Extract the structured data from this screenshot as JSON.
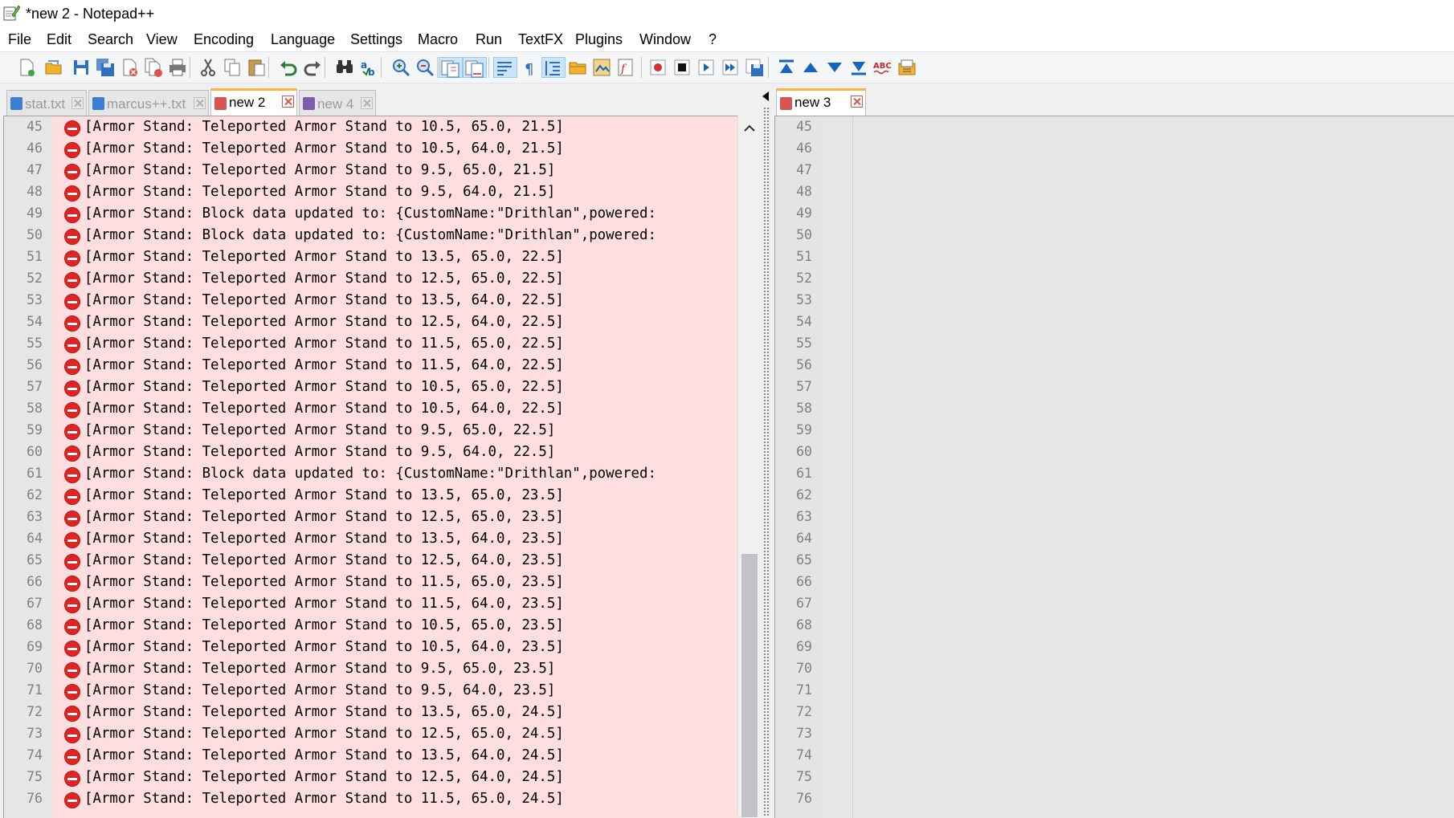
{
  "window": {
    "title": "*new  2 - Notepad++"
  },
  "menu": [
    "File",
    "Edit",
    "Search",
    "View",
    "Encoding",
    "Language",
    "Settings",
    "Macro",
    "Run",
    "TextFX",
    "Plugins",
    "Window",
    "?"
  ],
  "toolbar_icons": [
    "new-file-icon",
    "open-file-icon",
    "save-icon",
    "save-all-icon",
    "close-icon",
    "close-all-icon",
    "print-icon",
    "cut-icon",
    "copy-icon",
    "paste-icon",
    "undo-icon",
    "redo-icon",
    "find-icon",
    "replace-icon",
    "zoom-in-icon",
    "zoom-out-icon",
    "sync-vertical-icon",
    "sync-horizontal-icon",
    "word-wrap-icon",
    "show-all-chars-icon",
    "indent-guide-icon",
    "folder-icon",
    "document-map-icon",
    "function-list-icon",
    "record-macro-icon",
    "stop-recording-icon",
    "play-macro-icon",
    "run-macro-multiple-icon",
    "save-macro-icon",
    "first-diff-icon",
    "prev-diff-icon",
    "next-diff-icon",
    "last-diff-icon",
    "spell-check-icon",
    "compare-icon"
  ],
  "tabs_left": [
    {
      "label": "stat.txt",
      "color": "#3b7fd4",
      "active": false
    },
    {
      "label": "marcus++.txt",
      "color": "#3b7fd4",
      "active": false
    },
    {
      "label": "new  2",
      "color": "#d9534f",
      "active": true
    },
    {
      "label": "new  4",
      "color": "#7a5fb0",
      "active": false
    }
  ],
  "tabs_right": [
    {
      "label": "new  3",
      "color": "#d9534f",
      "active": true
    }
  ],
  "colors": {
    "removed_line_bg": "#ffdedf",
    "marker": "#e02424",
    "active_tab_accent": "#fab540"
  },
  "left_lines": [
    {
      "n": "45",
      "text": "[Armor Stand: Teleported Armor Stand to 10.5, 65.0, 21.5]"
    },
    {
      "n": "46",
      "text": "[Armor Stand: Teleported Armor Stand to 10.5, 64.0, 21.5]"
    },
    {
      "n": "47",
      "text": "[Armor Stand: Teleported Armor Stand to 9.5, 65.0, 21.5]"
    },
    {
      "n": "48",
      "text": "[Armor Stand: Teleported Armor Stand to 9.5, 64.0, 21.5]"
    },
    {
      "n": "49",
      "text": "[Armor Stand: Block data updated to: {CustomName:\"Drithlan\",powered:"
    },
    {
      "n": "50",
      "text": "[Armor Stand: Block data updated to: {CustomName:\"Drithlan\",powered:"
    },
    {
      "n": "51",
      "text": "[Armor Stand: Teleported Armor Stand to 13.5, 65.0, 22.5]"
    },
    {
      "n": "52",
      "text": "[Armor Stand: Teleported Armor Stand to 12.5, 65.0, 22.5]"
    },
    {
      "n": "53",
      "text": "[Armor Stand: Teleported Armor Stand to 13.5, 64.0, 22.5]"
    },
    {
      "n": "54",
      "text": "[Armor Stand: Teleported Armor Stand to 12.5, 64.0, 22.5]"
    },
    {
      "n": "55",
      "text": "[Armor Stand: Teleported Armor Stand to 11.5, 65.0, 22.5]"
    },
    {
      "n": "56",
      "text": "[Armor Stand: Teleported Armor Stand to 11.5, 64.0, 22.5]"
    },
    {
      "n": "57",
      "text": "[Armor Stand: Teleported Armor Stand to 10.5, 65.0, 22.5]"
    },
    {
      "n": "58",
      "text": "[Armor Stand: Teleported Armor Stand to 10.5, 64.0, 22.5]"
    },
    {
      "n": "59",
      "text": "[Armor Stand: Teleported Armor Stand to 9.5, 65.0, 22.5]"
    },
    {
      "n": "60",
      "text": "[Armor Stand: Teleported Armor Stand to 9.5, 64.0, 22.5]"
    },
    {
      "n": "61",
      "text": "[Armor Stand: Block data updated to: {CustomName:\"Drithlan\",powered:"
    },
    {
      "n": "62",
      "text": "[Armor Stand: Teleported Armor Stand to 13.5, 65.0, 23.5]"
    },
    {
      "n": "63",
      "text": "[Armor Stand: Teleported Armor Stand to 12.5, 65.0, 23.5]"
    },
    {
      "n": "64",
      "text": "[Armor Stand: Teleported Armor Stand to 13.5, 64.0, 23.5]"
    },
    {
      "n": "65",
      "text": "[Armor Stand: Teleported Armor Stand to 12.5, 64.0, 23.5]"
    },
    {
      "n": "66",
      "text": "[Armor Stand: Teleported Armor Stand to 11.5, 65.0, 23.5]"
    },
    {
      "n": "67",
      "text": "[Armor Stand: Teleported Armor Stand to 11.5, 64.0, 23.5]"
    },
    {
      "n": "68",
      "text": "[Armor Stand: Teleported Armor Stand to 10.5, 65.0, 23.5]"
    },
    {
      "n": "69",
      "text": "[Armor Stand: Teleported Armor Stand to 10.5, 64.0, 23.5]"
    },
    {
      "n": "70",
      "text": "[Armor Stand: Teleported Armor Stand to 9.5, 65.0, 23.5]"
    },
    {
      "n": "71",
      "text": "[Armor Stand: Teleported Armor Stand to 9.5, 64.0, 23.5]"
    },
    {
      "n": "72",
      "text": "[Armor Stand: Teleported Armor Stand to 13.5, 65.0, 24.5]"
    },
    {
      "n": "73",
      "text": "[Armor Stand: Teleported Armor Stand to 12.5, 65.0, 24.5]"
    },
    {
      "n": "74",
      "text": "[Armor Stand: Teleported Armor Stand to 13.5, 64.0, 24.5]"
    },
    {
      "n": "75",
      "text": "[Armor Stand: Teleported Armor Stand to 12.5, 64.0, 24.5]"
    },
    {
      "n": "76",
      "text": "[Armor Stand: Teleported Armor Stand to 11.5, 65.0, 24.5]"
    }
  ],
  "right_lines": [
    "45",
    "46",
    "47",
    "48",
    "49",
    "50",
    "51",
    "52",
    "53",
    "54",
    "55",
    "56",
    "57",
    "58",
    "59",
    "60",
    "61",
    "62",
    "63",
    "64",
    "65",
    "66",
    "67",
    "68",
    "69",
    "70",
    "71",
    "72",
    "73",
    "74",
    "75",
    "76"
  ]
}
